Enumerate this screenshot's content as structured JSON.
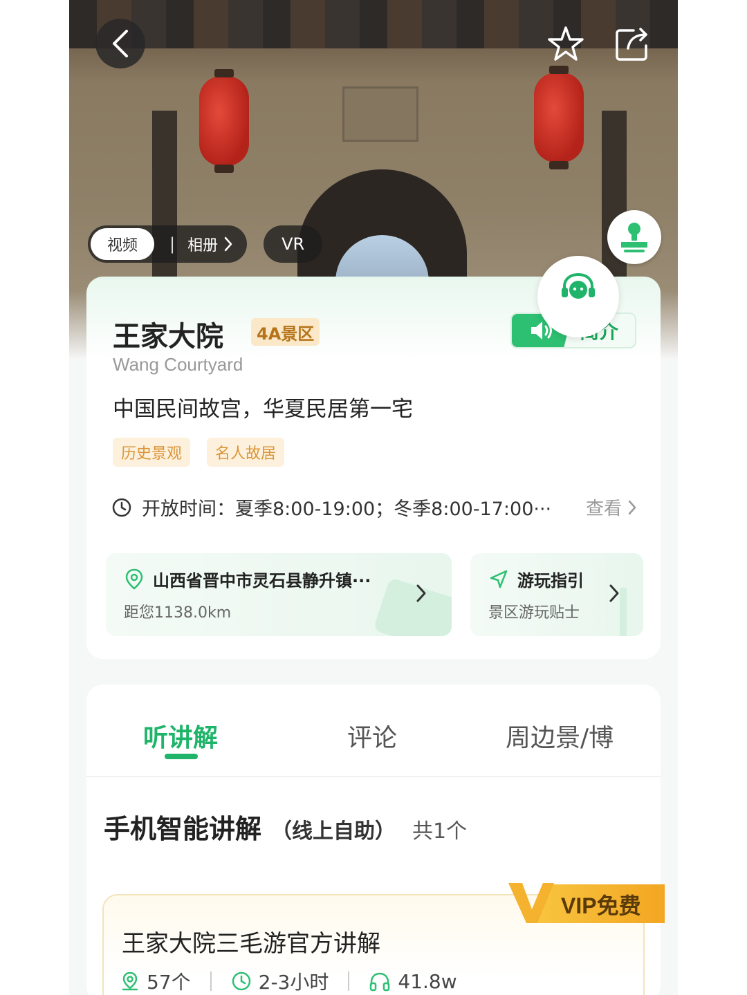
{
  "hero": {
    "media_tabs": {
      "video": "视频",
      "separator": "|",
      "album": "相册",
      "vr": "VR"
    }
  },
  "info": {
    "title": "王家大院",
    "level_badge": "4A景区",
    "intro_label": "简介",
    "en_name": "Wang Courtyard",
    "slogan": "中国民间故宫，华夏民居第一宅",
    "tags": [
      "历史景观",
      "名人故居"
    ],
    "hours_text": "开放时间：夏季8:00-19:00；冬季8:00-17:00···",
    "view_more": "查看",
    "location": {
      "address": "山西省晋中市灵石县静升镇···",
      "distance": "距您1138.0km"
    },
    "guide": {
      "title": "游玩指引",
      "subtitle": "景区游玩贴士"
    }
  },
  "tabs": [
    "听讲解",
    "评论",
    "周边景/博"
  ],
  "active_tab": "听讲解",
  "section": {
    "title": "手机智能讲解",
    "subtitle": "（线上自助）",
    "count": "共1个"
  },
  "guide_item": {
    "badge": "VIP免费",
    "name": "王家大院三毛游官方讲解",
    "spots": "57个",
    "duration": "2-3小时",
    "listens": "41.8w"
  },
  "colors": {
    "accent_green": "#1fb46a",
    "tag_orange": "#d99535",
    "vip_gold": "#f3a622"
  },
  "icons": [
    "back-arrow-icon",
    "star-icon",
    "share-icon",
    "stamp-icon",
    "speaker-icon",
    "clock-icon",
    "location-pin-icon",
    "navigation-icon",
    "chevron-right-icon",
    "headphones-icon",
    "customer-service-icon"
  ]
}
